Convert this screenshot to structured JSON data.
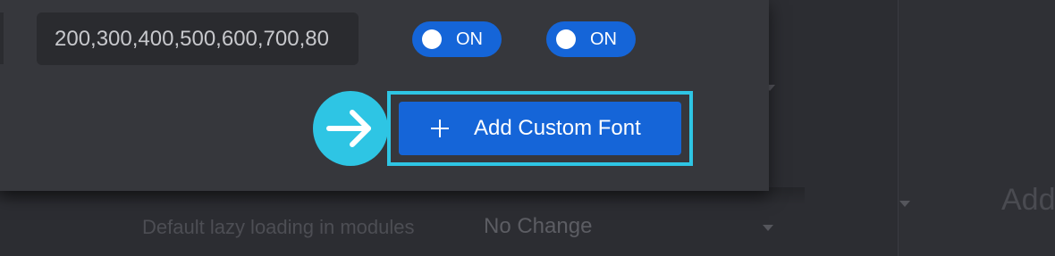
{
  "colors": {
    "accent_blue": "#1565d8",
    "highlight_cyan": "#2ec5e4",
    "modal_bg": "#36373c",
    "page_bg": "#2c2d32"
  },
  "font_form": {
    "weights_input_value": "200,300,400,500,600,700,80",
    "toggle_1": {
      "state": "ON",
      "on": true
    },
    "toggle_2": {
      "state": "ON",
      "on": true
    },
    "add_button_label": "Add Custom Font",
    "add_button_icon": "plus-icon",
    "pointer_icon": "arrow-right-icon"
  },
  "background": {
    "row_label": "Default lazy loading in modules",
    "row_value": "No Change",
    "right_text": "Add"
  }
}
